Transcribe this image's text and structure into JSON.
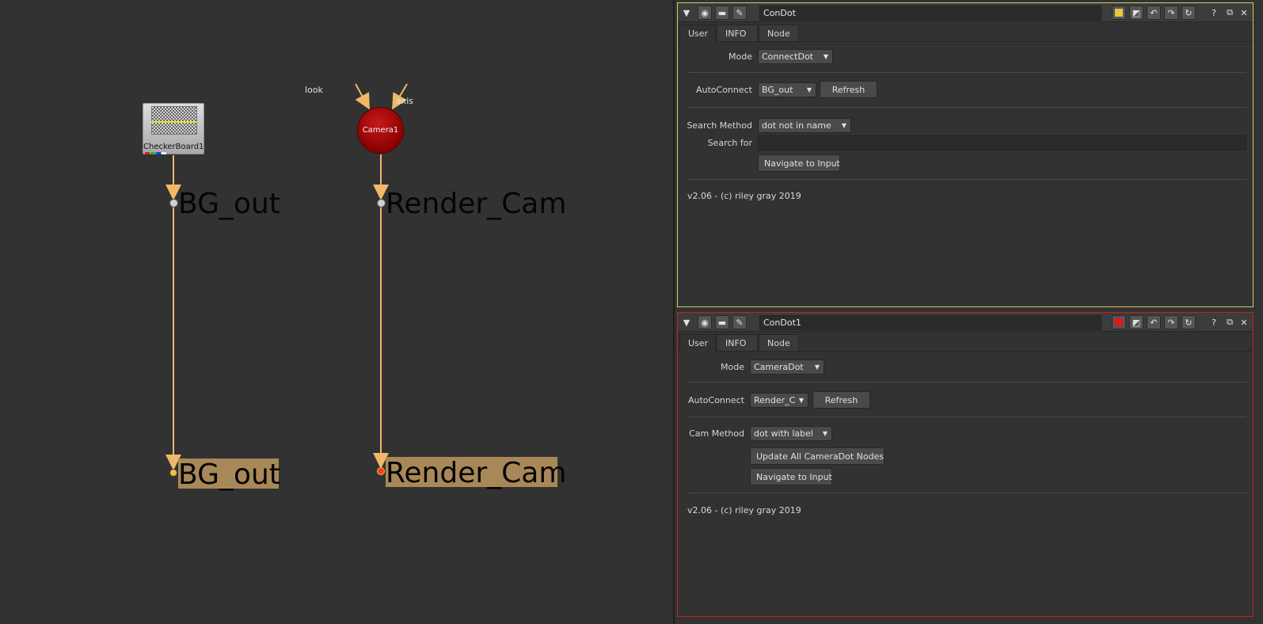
{
  "graph": {
    "checker_node_label": "CheckerBoard1",
    "camera_node_label": "Camera1",
    "camera_input_look": "look",
    "camera_input_axis": "axis",
    "dot_bg_top": "BG_out",
    "dot_cam_top": "Render_Cam",
    "dot_bg_bottom": "BG_out",
    "dot_cam_bottom": "Render_Cam",
    "wire_color": "#f0b868"
  },
  "panel1": {
    "name": "ConDot",
    "color_chip": "#e8c83c",
    "border_color": "#d4cc5a",
    "tabs": [
      "User",
      "INFO",
      "Node"
    ],
    "mode_label": "Mode",
    "mode_value": "ConnectDot",
    "autoconnect_label": "AutoConnect",
    "autoconnect_value": "BG_out",
    "refresh_label": "Refresh",
    "search_method_label": "Search Method",
    "search_method_value": "dot not in name",
    "search_for_label": "Search for",
    "search_for_value": "",
    "navigate_label": "Navigate to Input",
    "version_text": "v2.06 - (c) riley gray 2019"
  },
  "panel2": {
    "name": "ConDot1",
    "color_chip": "#e01818",
    "border_color": "#c82020",
    "tabs": [
      "User",
      "INFO",
      "Node"
    ],
    "mode_label": "Mode",
    "mode_value": "CameraDot",
    "autoconnect_label": "AutoConnect",
    "autoconnect_value": "Render_C",
    "refresh_label": "Refresh",
    "cam_method_label": "Cam Method",
    "cam_method_value": "dot with label",
    "update_label": "Update All CameraDot Nodes",
    "navigate_label": "Navigate to Input",
    "version_text": "v2.06 - (c) riley gray 2019"
  },
  "icons": {
    "collapse": "triangle-down-icon",
    "help": "?",
    "float": "float-window-icon",
    "close": "×"
  }
}
